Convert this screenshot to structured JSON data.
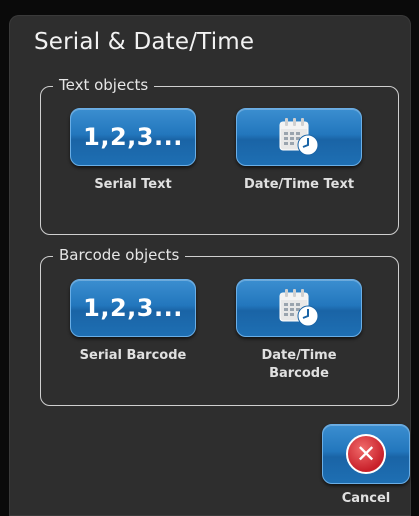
{
  "dialog": {
    "title": "Serial & Date/Time"
  },
  "text_objects": {
    "legend": "Text objects",
    "serial": {
      "glyph": "1,2,3...",
      "label": "Serial Text",
      "icon": "numbers-icon"
    },
    "datetime": {
      "label": "Date/Time Text",
      "icon": "calendar-clock-icon"
    }
  },
  "barcode_objects": {
    "legend": "Barcode objects",
    "serial": {
      "glyph": "1,2,3...",
      "label": "Serial Barcode",
      "icon": "numbers-icon"
    },
    "datetime": {
      "label_line1": "Date/Time",
      "label_line2": "Barcode",
      "icon": "calendar-clock-icon"
    }
  },
  "cancel": {
    "label": "Cancel",
    "icon": "close-icon"
  },
  "colors": {
    "button_blue": "#2377bd",
    "cancel_red": "#c8202a",
    "dialog_bg": "#2e2e2e"
  }
}
